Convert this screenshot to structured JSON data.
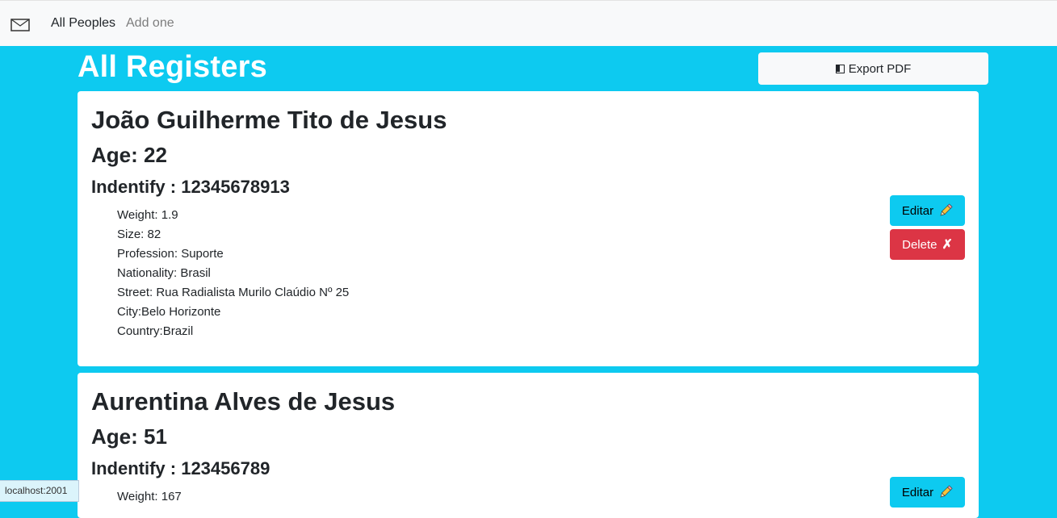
{
  "navbar": {
    "brand_icon": "envelope-icon",
    "links": [
      {
        "label": "All Peoples",
        "active": true
      },
      {
        "label": "Add one",
        "active": false
      }
    ]
  },
  "page": {
    "title": "All Registers",
    "export_label": "Export PDF",
    "export_icon": "half-square-icon"
  },
  "people": [
    {
      "name": "João Guilherme Tito de Jesus",
      "age": "Age: 22",
      "identify": "Indentify : 12345678913",
      "details": [
        "Weight: 1.9",
        "Size: 82",
        "Profession: Suporte",
        "Nationality: Brasil",
        "Street: Rua Radialista Murilo Claúdio Nº 25",
        "City:Belo Horizonte",
        "Country:Brazil"
      ],
      "edit_label": "Editar",
      "delete_label": "Delete",
      "delete_icon": "✗"
    },
    {
      "name": "Aurentina Alves de Jesus",
      "age": "Age: 51",
      "identify": "Indentify : 123456789",
      "details": [
        "Weight: 167"
      ],
      "edit_label": "Editar"
    }
  ],
  "status_bar": {
    "url": "localhost:2001"
  },
  "colors": {
    "background": "#0dcaf0",
    "navbar": "#f8f9fa",
    "edit": "#0dcaf0",
    "delete": "#dc3545"
  }
}
